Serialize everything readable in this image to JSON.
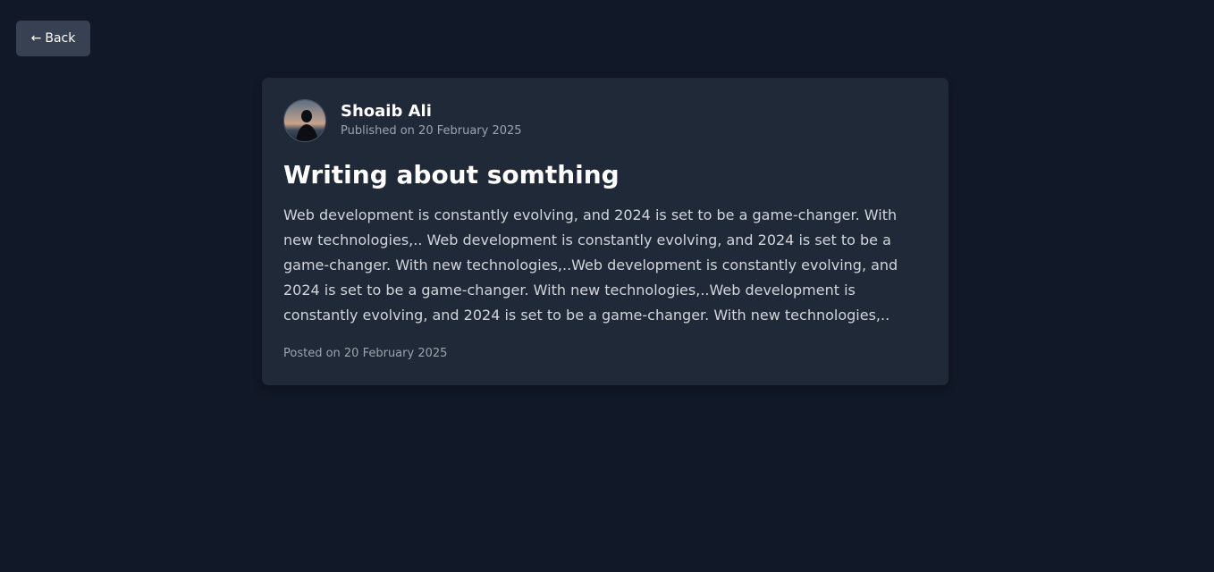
{
  "back_button": {
    "arrow_icon": "←",
    "label": "Back"
  },
  "post": {
    "author": {
      "name": "Shoaib Ali",
      "avatar_icon": "avatar-silhouette"
    },
    "published": "Published on 20 February 2025",
    "title": "Writing about somthing",
    "body": "Web development is constantly evolving, and 2024 is set to be a game-changer. With new technologies,.. Web development is constantly evolving, and 2024 is set to be a game-changer. With new technologies,..Web development is constantly evolving, and 2024 is set to be a game-changer. With new technologies,..Web development is constantly evolving, and 2024 is set to be a game-changer. With new technologies,..",
    "posted": "Posted on 20 February 2025"
  },
  "colors": {
    "page_background": "#111827",
    "card_background": "#1f2937",
    "button_background": "#374151",
    "title_text": "#ffffff",
    "body_text": "#d1d5db",
    "muted_text": "#9ca3af"
  }
}
